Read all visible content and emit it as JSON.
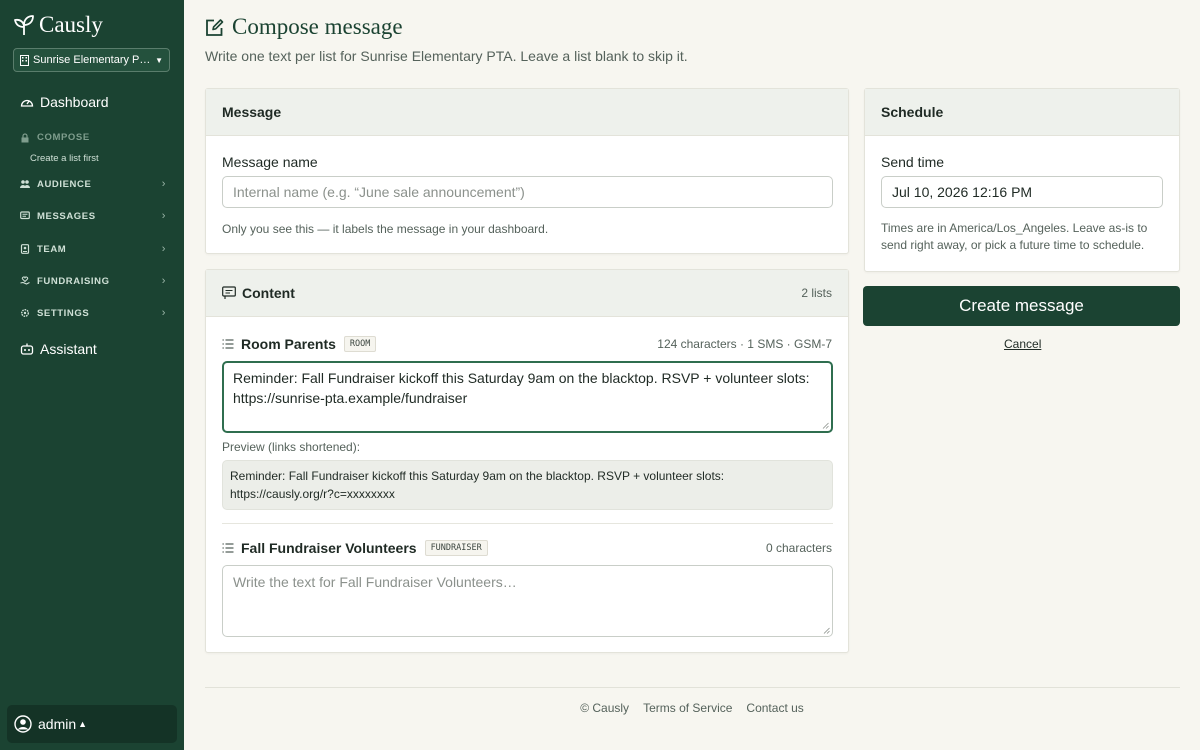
{
  "brand": {
    "name": "Causly"
  },
  "sidebar": {
    "org_selector": "Sunrise Elementary PTA",
    "dashboard": "Dashboard",
    "compose": {
      "label": "COMPOSE",
      "sub": "Create a list first"
    },
    "sections": [
      {
        "label": "AUDIENCE",
        "icon": "people-icon"
      },
      {
        "label": "MESSAGES",
        "icon": "chat-icon"
      },
      {
        "label": "TEAM",
        "icon": "badge-icon"
      },
      {
        "label": "FUNDRAISING",
        "icon": "heart-hand-icon"
      },
      {
        "label": "SETTINGS",
        "icon": "gear-icon"
      }
    ],
    "assistant": "Assistant",
    "user": "admin"
  },
  "page": {
    "title": "Compose message",
    "subtitle": "Write one text per list for Sunrise Elementary PTA. Leave a list blank to skip it."
  },
  "message_card": {
    "header": "Message",
    "name_label": "Message name",
    "name_placeholder": "Internal name (e.g. “June sale announcement”)",
    "name_help": "Only you see this — it labels the message in your dashboard."
  },
  "content_card": {
    "header": "Content",
    "list_count": "2 lists",
    "lists": [
      {
        "name": "Room Parents",
        "tag": "ROOM",
        "meta": "124 characters · 1 SMS · GSM-7",
        "text": "Reminder: Fall Fundraiser kickoff this Saturday 9am on the blacktop. RSVP + volunteer slots: https://sunrise-pta.example/fundraiser",
        "preview_label": "Preview (links shortened):",
        "preview": "Reminder: Fall Fundraiser kickoff this Saturday 9am on the blacktop. RSVP + volunteer slots: https://causly.org/r?c=xxxxxxxx"
      },
      {
        "name": "Fall Fundraiser Volunteers",
        "tag": "FUNDRAISER",
        "meta": "0 characters",
        "placeholder": "Write the text for Fall Fundraiser Volunteers…"
      }
    ]
  },
  "schedule_card": {
    "header": "Schedule",
    "send_label": "Send time",
    "send_value": "Jul 10, 2026 12:16 PM",
    "help": "Times are in America/Los_Angeles. Leave as-is to send right away, or pick a future time to schedule."
  },
  "actions": {
    "create": "Create message",
    "cancel": "Cancel"
  },
  "footer": {
    "copyright": "© Causly",
    "terms": "Terms of Service",
    "contact": "Contact us"
  },
  "colors": {
    "sidebar": "#1b4332",
    "accent": "#1b4332",
    "background": "#f7f6f0"
  }
}
